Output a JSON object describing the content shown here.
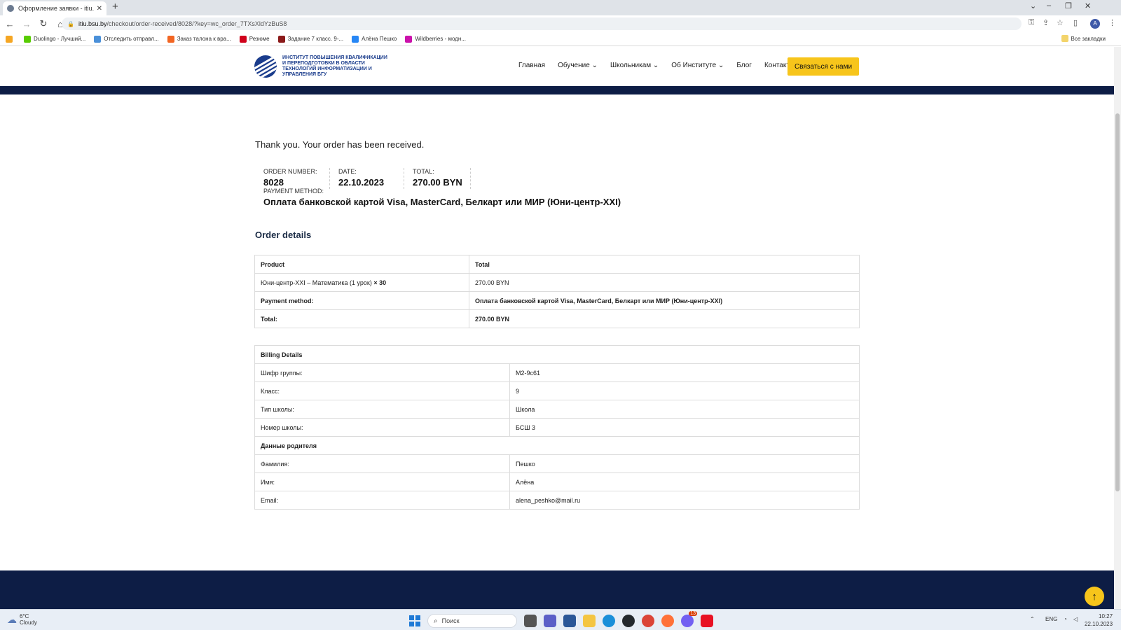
{
  "browser": {
    "tab_title": "Оформление заявки - itiu.bsu.by",
    "tab_close": "✕",
    "new_tab": "+",
    "url_host": "itiu.bsu.by",
    "url_path": "/checkout/order-received/8028/?key=wc_order_7TXsXldYzBuS8",
    "profile_initial": "A"
  },
  "bookmarks": {
    "items": [
      {
        "label": "Duolingo - Лучший...",
        "color": "#58cc02"
      },
      {
        "label": "Отследить отправл...",
        "color": "#4a90d9"
      },
      {
        "label": "Заказ талона к вра...",
        "color": "#f26522"
      },
      {
        "label": "Резюме",
        "color": "#d0021b"
      },
      {
        "label": "Задание 7 класс. 9-...",
        "color": "#8b1a1a"
      },
      {
        "label": "Алёна Пешко",
        "color": "#2787f5"
      },
      {
        "label": "Wildberries - модн...",
        "color": "#cb11ab"
      }
    ],
    "all_label": "Все закладки"
  },
  "site": {
    "logo_text": "Институт повышения квалификации и переподготовки в области технологий информатизации и управления БГУ",
    "nav": [
      {
        "label": "Главная"
      },
      {
        "label": "Обучение ⌄"
      },
      {
        "label": "Школьникам ⌄"
      },
      {
        "label": "Об Институте ⌄"
      },
      {
        "label": "Блог"
      },
      {
        "label": "Контакты"
      }
    ],
    "cta_label": "Связаться с нами",
    "accent_color": "#f7c51b",
    "navy_color": "#0d1d45"
  },
  "order": {
    "thanks": "Thank you. Your order has been received.",
    "number_label": "ORDER NUMBER:",
    "number": "8028",
    "date_label": "DATE:",
    "date": "22.10.2023",
    "total_label": "TOTAL:",
    "total": "270.00 BYN",
    "payment_label": "PAYMENT METHOD:",
    "payment": "Оплата банковской картой Visa, MasterCard, Белкарт или МИР (Юни-центр-XXI)"
  },
  "order_details": {
    "heading": "Order details",
    "col_product": "Product",
    "col_total": "Total",
    "item_name": "Юни-центр-XXI – Математика (1 урок)",
    "item_qty": "× 30",
    "item_total": "270.00 BYN",
    "payment_label": "Payment method:",
    "payment_value": "Оплата банковской картой Visa, MasterCard, Белкарт или МИР (Юни-центр-XXI)",
    "total_label": "Total:",
    "total_value": "270.00 BYN"
  },
  "billing": {
    "heading": "Billing Details",
    "rows": [
      {
        "label": "Шифр группы:",
        "value": "M2-9c61"
      },
      {
        "label": "Класс:",
        "value": "9"
      },
      {
        "label": "Тип школы:",
        "value": "Школа"
      },
      {
        "label": "Номер школы:",
        "value": "БСШ 3"
      }
    ],
    "parents_heading": "Данные родителя",
    "parent_rows": [
      {
        "label": "Фамилия:",
        "value": "Пешко"
      },
      {
        "label": "Имя:",
        "value": "Алёна"
      },
      {
        "label": "Email:",
        "value": "alena_peshko@mail.ru"
      }
    ]
  },
  "taskbar": {
    "temp": "6°C",
    "weather": "Cloudy",
    "search": "Поиск",
    "lang": "ENG",
    "time": "10:27",
    "date": "22.10.2023",
    "notif_count": "13"
  }
}
